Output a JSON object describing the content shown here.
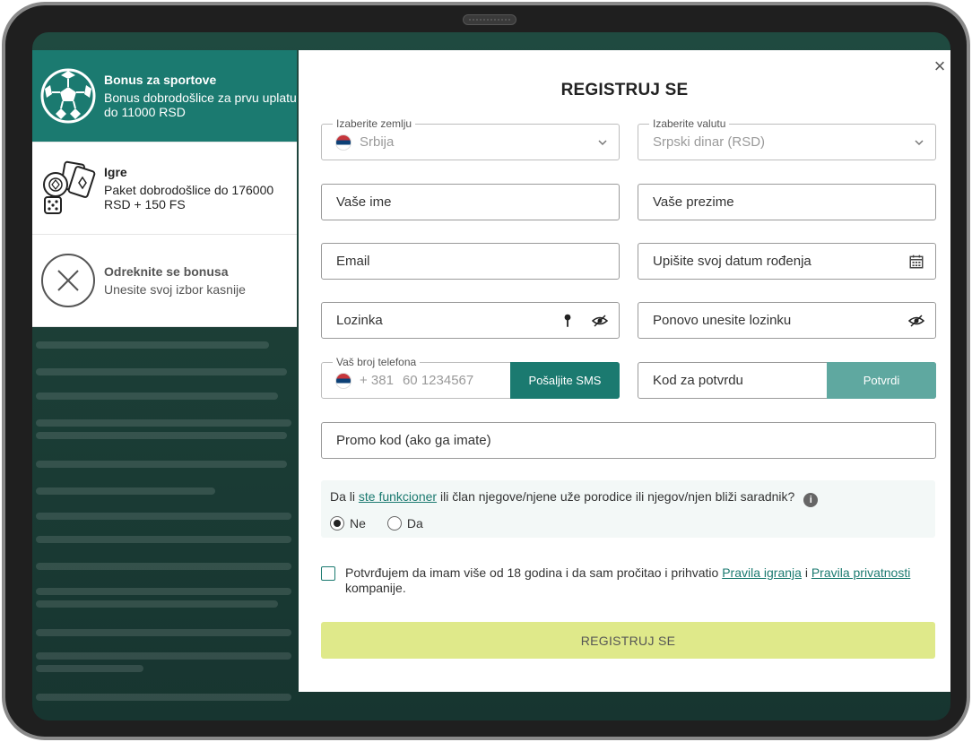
{
  "bonus_panel": {
    "items": [
      {
        "title": "Bonus za sportove",
        "desc": "Bonus dobrodošlice za prvu uplatu do 11000 RSD",
        "icon": "soccer-ball-icon"
      },
      {
        "title": "Igre",
        "desc": "Paket dobrodošlice do 176000 RSD + 150 FS",
        "icon": "casino-chips-cards-icon"
      },
      {
        "title": "Odreknite se bonusa",
        "desc": "Unesite svoj izbor kasnije",
        "icon": "close-circle-icon"
      }
    ]
  },
  "modal": {
    "title": "REGISTRUJ SE",
    "close_icon": "×",
    "country": {
      "label": "Izaberite zemlju",
      "value": "Srbija"
    },
    "currency": {
      "label": "Izaberite valutu",
      "value": "Srpski dinar (RSD)"
    },
    "first_name": {
      "placeholder": "Vaše ime"
    },
    "last_name": {
      "placeholder": "Vaše prezime"
    },
    "email": {
      "placeholder": "Email"
    },
    "birth_date": {
      "placeholder": "Upišite svoj datum rođenja"
    },
    "password": {
      "placeholder": "Lozinka"
    },
    "password_repeat": {
      "placeholder": "Ponovo unesite lozinku"
    },
    "phone": {
      "label": "Vaš broj telefona",
      "prefix": "+ 381",
      "placeholder": "60 1234567",
      "sms_button": "Pošaljite SMS"
    },
    "code": {
      "placeholder": "Kod za potvrdu",
      "confirm_button": "Potvrdi"
    },
    "promo": {
      "placeholder": "Promo kod (ako ga imate)"
    },
    "question": {
      "before": "Da li ",
      "link": "ste funkcioner",
      "after": " ili član njegove/njene uže porodice ili njegov/njen bliži saradnik?",
      "info": "i",
      "options": [
        "Ne",
        "Da"
      ],
      "selected": "Ne"
    },
    "terms": {
      "text_before": "Potvrđujem da imam više od 18 godina i da sam pročitao i prihvatio ",
      "link1": "Pravila igranja",
      "mid": " i ",
      "link2": "Pravila privatnosti",
      "text_after": " kompanije."
    },
    "register_button": "REGISTRUJ SE"
  },
  "colors": {
    "accent": "#1b7a70",
    "accent_light": "#5fa8a0",
    "register_bg": "#dfe98a",
    "background": "#1f4a40"
  }
}
